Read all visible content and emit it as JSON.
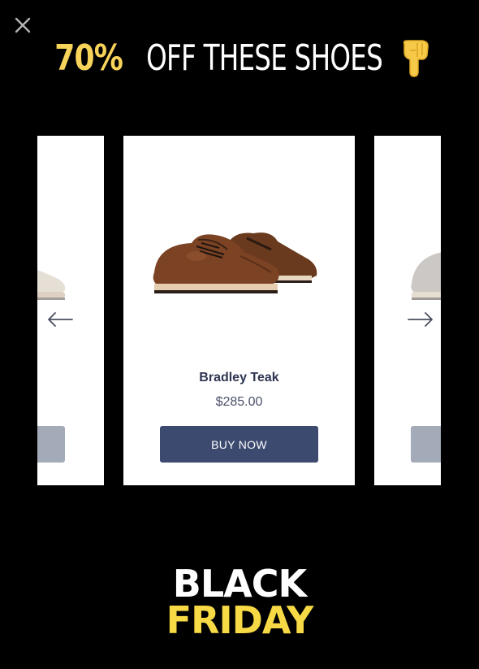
{
  "popup": {
    "close_icon": "close-icon",
    "headline": {
      "percent": "70%",
      "rest": "OFF THESE SHOES",
      "icon": "pointing-down-hand-icon",
      "accent_color": "#f7d35a"
    },
    "carousel": {
      "prev_icon": "arrow-left-icon",
      "next_icon": "arrow-right-icon",
      "current_product": {
        "name": "Bradley Teak",
        "price": "$285.00",
        "button_label": "BUY NOW",
        "button_color": "#3c4a70",
        "shoe_color": "#7b4324"
      },
      "previous_product_shoe_color": "#c8b9a6",
      "next_product_shoe_color": "#8f877f"
    },
    "banner": {
      "line1": "BLACK",
      "line2": "FRIDAY",
      "line1_color": "#ffffff",
      "line2_color": "#f7d946"
    }
  }
}
